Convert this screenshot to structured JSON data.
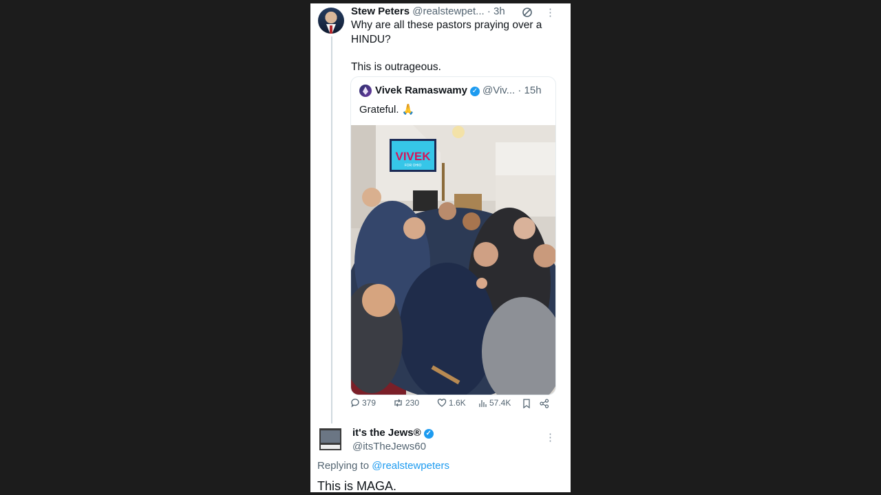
{
  "tweet": {
    "author_name": "Stew Peters",
    "author_handle": "@realstewpet...",
    "time": "· 3h",
    "text_line1": "Why are all these pastors praying over a HINDU?",
    "text_line2": "This is outrageous."
  },
  "quote": {
    "author_name": "Vivek Ramaswamy",
    "author_handle": "@Viv...",
    "time": "· 15h",
    "text": "Grateful. 🙏",
    "photo_sign_text": "VIVEK",
    "photo_sign_sub": "FOR OHIO"
  },
  "actions": {
    "replies": "379",
    "reposts": "230",
    "likes": "1.6K",
    "views": "57.4K"
  },
  "reply": {
    "author_name": "it's the Jews®",
    "author_handle": "@itsTheJews60",
    "replying_prefix": "Replying to",
    "replying_to": "@realstewpeters",
    "text": "This is MAGA."
  },
  "colors": {
    "background": "#1c1c1c",
    "accent": "#1d9bf0",
    "text": "#0f1419",
    "secondary": "#536471"
  }
}
